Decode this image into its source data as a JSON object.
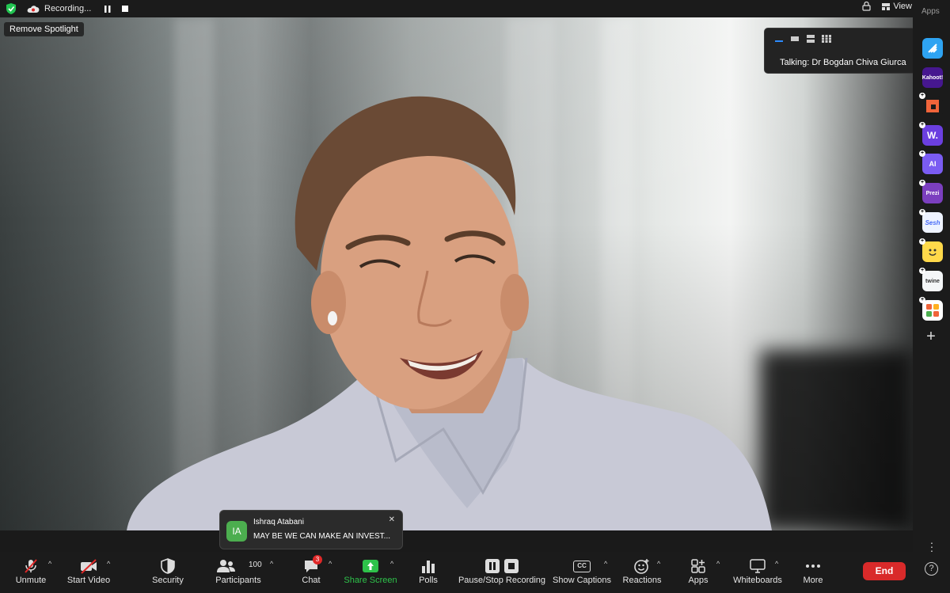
{
  "topbar": {
    "recording_label": "Recording...",
    "view_label": "View",
    "apps_label": "Apps"
  },
  "spotlight": {
    "remove_label": "Remove Spotlight"
  },
  "talking": {
    "text": "Talking: Dr Bogdan Chiva Giurca"
  },
  "chat_toast": {
    "avatar_initials": "IA",
    "sender": "Ishraq Atabani",
    "message": "MAY BE WE CAN MAKE AN INVEST..."
  },
  "apps_sidebar": {
    "items": [
      {
        "name": "slido-icon",
        "color": "#2ea3f2"
      },
      {
        "name": "kahoot-icon",
        "label": "Kahoot!",
        "color": "#46178f"
      },
      {
        "name": "orange-app-icon",
        "color": "#f0643a"
      },
      {
        "name": "wooclap-icon",
        "label": "W.",
        "color": "#6b3fe0"
      },
      {
        "name": "ai-app-icon",
        "label": "AI",
        "color": "#7a5cf2"
      },
      {
        "name": "prezi-icon",
        "label": "Prezi",
        "color": "#7b3fbf"
      },
      {
        "name": "sesh-icon",
        "label": "Sesh",
        "color": "#eef3ff"
      },
      {
        "name": "emoji-app-icon",
        "color": "#ffd94a"
      },
      {
        "name": "twine-icon",
        "label": "twine",
        "color": "#f4f6f8"
      },
      {
        "name": "grid-app-icon",
        "color": "#ffffff"
      }
    ]
  },
  "toolbar": {
    "unmute": "Unmute",
    "start_video": "Start Video",
    "security": "Security",
    "participants": "Participants",
    "participants_count": "100",
    "chat": "Chat",
    "chat_badge": "3",
    "share_screen": "Share Screen",
    "polls": "Polls",
    "pause_stop_recording": "Pause/Stop Recording",
    "show_captions": "Show Captions",
    "reactions": "Reactions",
    "apps": "Apps",
    "whiteboards": "Whiteboards",
    "more": "More",
    "end": "End",
    "cc_icon_text": "CC"
  },
  "colors": {
    "share_green": "#2ec24a",
    "end_red": "#d92a2a",
    "badge_red": "#e02828"
  }
}
